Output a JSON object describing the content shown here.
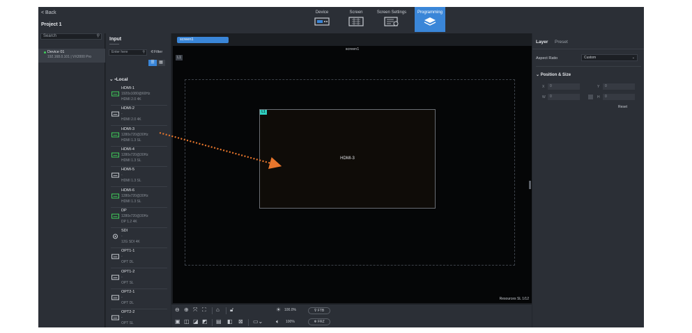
{
  "header": {
    "back_label": "< Back",
    "project_title": "Project 1",
    "modes": [
      {
        "label": "Device",
        "icon": "device-icon"
      },
      {
        "label": "Screen",
        "icon": "screen-icon"
      },
      {
        "label": "Screen Settings",
        "icon": "screen-settings-icon"
      },
      {
        "label": "Programming",
        "icon": "programming-layers-icon",
        "active": true
      }
    ]
  },
  "devices": {
    "search_placeholder": "Search",
    "items": [
      {
        "name": "Device 01",
        "meta": "192.168.0.101 | VX2000 Pro",
        "status_color": "#3fcf5a"
      }
    ]
  },
  "input_panel": {
    "title": "Input",
    "search_placeholder": "Enter here",
    "filter_label": "Filter",
    "group_label": "Local",
    "sources": [
      {
        "name": "HDMI-1",
        "resolution": "1920x1080@60Hz",
        "type": "HDMI 2.0 4K",
        "signal": true
      },
      {
        "name": "HDMI-2",
        "resolution": "-",
        "type": "HDMI 2.0 4K",
        "signal": false
      },
      {
        "name": "HDMI-3",
        "resolution": "1280x720@30Hz",
        "type": "HDMI 1.3 SL",
        "signal": true
      },
      {
        "name": "HDMI-4",
        "resolution": "1280x720@30Hz",
        "type": "HDMI 1.3 SL",
        "signal": true
      },
      {
        "name": "HDMI-5",
        "resolution": "-",
        "type": "HDMI 1.3 SL",
        "signal": false
      },
      {
        "name": "HDMI-6",
        "resolution": "1280x720@30Hz",
        "type": "HDMI 1.3 SL",
        "signal": true
      },
      {
        "name": "DP",
        "resolution": "1280x720@30Hz",
        "type": "DP 1.2 4K",
        "signal": true
      },
      {
        "name": "SDI",
        "resolution": "-",
        "type": "12G SDI 4K",
        "signal": false
      },
      {
        "name": "OPT1-1",
        "resolution": "-",
        "type": "OPT DL",
        "signal": false
      },
      {
        "name": "OPT1-2",
        "resolution": "-",
        "type": "OPT SL",
        "signal": false
      },
      {
        "name": "OPT2-1",
        "resolution": "-",
        "type": "OPT DL",
        "signal": false
      },
      {
        "name": "OPT2-2",
        "resolution": "-",
        "type": "OPT SL",
        "signal": false
      }
    ]
  },
  "canvas": {
    "screen_tab": "screen1",
    "screen_name": "screen1",
    "layer_badge": "L1",
    "window_badge": "L1",
    "window_source": "HDMI-3",
    "resources": "Resources SL  1/12"
  },
  "toolbar": {
    "brightness": "100.0%",
    "volume": "100%",
    "ftb_label": "FTB",
    "frz_label": "FRZ"
  },
  "properties": {
    "tabs": [
      "Layer",
      "Preset"
    ],
    "aspect_label": "Aspect Ratio",
    "aspect_value": "Custom",
    "section_title": "Position & Size",
    "x_label": "X",
    "x_value": "0",
    "y_label": "Y",
    "y_value": "0",
    "w_label": "W",
    "w_value": "0",
    "h_label": "H",
    "h_value": "0",
    "reset_label": "Reset"
  },
  "colors": {
    "accent": "#3a86d8",
    "drag_arrow": "#e8762c",
    "layer_badge": "#2fd0c0"
  }
}
